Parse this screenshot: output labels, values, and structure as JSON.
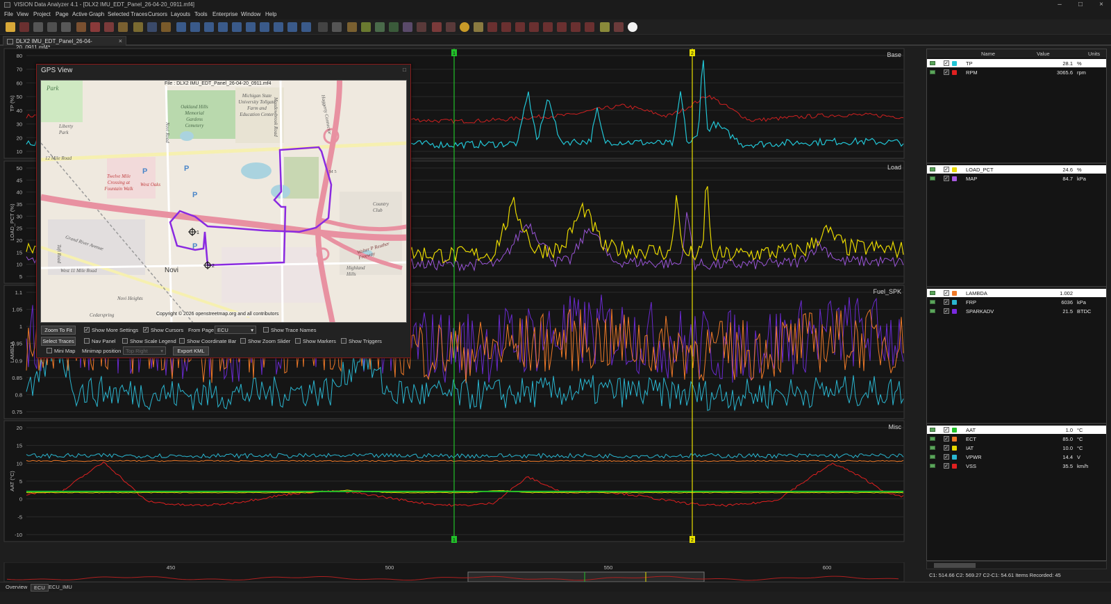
{
  "window": {
    "title": "VISION Data Analyzer 4.1 - [DLX2 IMU_EDT_Panel_26-04-20_0911.mf4]",
    "controls": [
      "–",
      "□",
      "×"
    ]
  },
  "menu": [
    "File",
    "View",
    "Project",
    "Page",
    "Active Graph",
    "Selected Traces",
    "Cursors",
    "Layouts",
    "Tools",
    "Enterprise",
    "Window",
    "Help"
  ],
  "tab": {
    "label": "DLX2 IMU_EDT_Panel_26-04-20_0911.mf4*",
    "close": "×"
  },
  "panels": [
    {
      "name": "Base",
      "ylabel": "TP (%)",
      "ticks": [
        "80",
        "70",
        "60",
        "50",
        "40",
        "30",
        "20",
        "10"
      ]
    },
    {
      "name": "Load",
      "ylabel": "LOAD_PCT (%)",
      "ticks": [
        "50",
        "45",
        "40",
        "35",
        "30",
        "25",
        "20",
        "15",
        "10",
        "5"
      ]
    },
    {
      "name": "Fuel_SPK",
      "ylabel": "LAMBDA",
      "ticks": [
        "1.1",
        "1.05",
        "1",
        "0.95",
        "0.9",
        "0.85",
        "0.8",
        "0.75"
      ]
    },
    {
      "name": "Misc",
      "ylabel": "AAT (°C)",
      "ticks": [
        "20",
        "15",
        "10",
        "5",
        "0",
        "-5",
        "-10"
      ]
    }
  ],
  "cursors": [
    {
      "label": "1",
      "color": "#22c12a"
    },
    {
      "label": "2",
      "color": "#e8e000"
    }
  ],
  "xaxis": {
    "ticks": [
      "450",
      "500",
      "550",
      "600"
    ]
  },
  "legend": {
    "headers": {
      "name": "Name",
      "value": "Value",
      "units": "Units"
    },
    "groups": [
      [
        {
          "name": "TP",
          "value": "28.1",
          "unit": "%",
          "color": "#22c6d6",
          "selected": true
        },
        {
          "name": "RPM",
          "value": "3065.6",
          "unit": "rpm",
          "color": "#e02020",
          "selected": false
        }
      ],
      [
        {
          "name": "LOAD_PCT",
          "value": "24.6",
          "unit": "%",
          "color": "#e8d800",
          "selected": true
        },
        {
          "name": "MAP",
          "value": "84.7",
          "unit": "kPa",
          "color": "#a85ae0",
          "selected": false
        }
      ],
      [
        {
          "name": "LAMBDA",
          "value": "1.002",
          "unit": "",
          "color": "#f07a28",
          "selected": true
        },
        {
          "name": "FRP",
          "value": "6036",
          "unit": "kPa",
          "color": "#2ab6d0",
          "selected": false
        },
        {
          "name": "SPARKADV",
          "value": "21.5",
          "unit": "BTDC",
          "color": "#7a2ae0",
          "selected": false
        }
      ],
      [
        {
          "name": "AAT",
          "value": "1.0",
          "unit": "°C",
          "color": "#22c12a",
          "selected": true
        },
        {
          "name": "ECT",
          "value": "85.0",
          "unit": "°C",
          "color": "#f07a28",
          "selected": false
        },
        {
          "name": "IAT",
          "value": "10.0",
          "unit": "°C",
          "color": "#e8d800",
          "selected": false
        },
        {
          "name": "VPWR",
          "value": "14.4",
          "unit": "V",
          "color": "#2ab6d0",
          "selected": false
        },
        {
          "name": "VSS",
          "value": "35.5",
          "unit": "km/h",
          "color": "#e02020",
          "selected": false
        }
      ]
    ]
  },
  "status": "C1: 514.66   C2: 569.27   C2-C1: 54.61   Items Recorded: 45",
  "pages": [
    "Overview",
    "ECU",
    "ECU_IMU"
  ],
  "gps": {
    "title": "GPS View",
    "close": "□",
    "file_label": "File : DLX2 IMU_EDT_Panel_26-04-20_0911.mf4",
    "copyright": "Copyright © 2026 openstreetmap.org and all contributors",
    "map_labels": [
      "Park",
      "Michigan State University Tollgate Farm and Education Center",
      "Oakland Hills Memorial Gardens Cemetery",
      "Twelve Mile Crossing at Fountain Walk",
      "West Oaks",
      "Grand River Avenue",
      "Novi",
      "West 11 Mile Road",
      "Haggerty Connector",
      "Country Club",
      "Novi Heights",
      "Cedarspring",
      "12 Mile Road",
      "Meadowbrook Road",
      "Novi Road",
      "Taft Road",
      "Walter P Reuther Freeway",
      "M 5",
      "Highland Hills",
      "Liberty Park"
    ],
    "buttons": {
      "zoom_to_fit": "Zoom To Fit",
      "select_traces": "Select Traces",
      "export_kml": "Export KML"
    },
    "checks": {
      "show_more_settings": "Show More Settings",
      "show_cursors": "Show Cursors",
      "from_page": "From Page",
      "show_trace_names": "Show Trace Names",
      "nav_panel": "Nav Panel",
      "show_scale_legend": "Show Scale Legend",
      "show_coordinate_bar": "Show Coordinate Bar",
      "show_zoom_slider": "Show Zoom Slider",
      "show_markers": "Show Markers",
      "show_triggers": "Show Triggers",
      "mini_map": "Mini Map",
      "minimap_position": "Minimap position"
    },
    "from_page_value": "ECU",
    "minimap_value": "Top Right"
  }
}
